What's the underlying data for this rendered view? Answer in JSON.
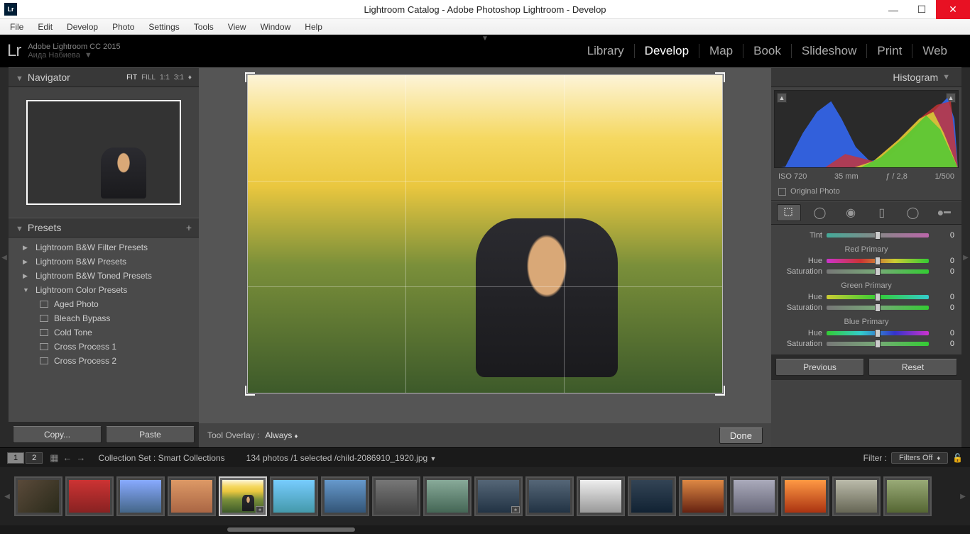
{
  "window": {
    "title": "Lightroom Catalog - Adobe Photoshop Lightroom - Develop",
    "lr_badge": "Lr"
  },
  "menu": [
    "File",
    "Edit",
    "Develop",
    "Photo",
    "Settings",
    "Tools",
    "View",
    "Window",
    "Help"
  ],
  "identity": {
    "logo": "Lr",
    "line1": "Adobe Lightroom CC 2015",
    "line2": "Аида Набиева"
  },
  "modules": [
    "Library",
    "Develop",
    "Map",
    "Book",
    "Slideshow",
    "Print",
    "Web"
  ],
  "active_module": 1,
  "navigator": {
    "title": "Navigator",
    "fit": "FIT",
    "fill": "FILL",
    "one": "1:1",
    "three": "3:1"
  },
  "presets": {
    "title": "Presets",
    "groups": [
      {
        "label": "Lightroom B&W Filter Presets",
        "expanded": false
      },
      {
        "label": "Lightroom B&W Presets",
        "expanded": false
      },
      {
        "label": "Lightroom B&W Toned Presets",
        "expanded": false
      },
      {
        "label": "Lightroom Color Presets",
        "expanded": true
      }
    ],
    "items": [
      "Aged Photo",
      "Bleach Bypass",
      "Cold Tone",
      "Cross Process 1",
      "Cross Process 2"
    ]
  },
  "copy_btn": "Copy...",
  "paste_btn": "Paste",
  "overlay": {
    "label": "Tool Overlay :",
    "value": "Always"
  },
  "done_btn": "Done",
  "histogram": {
    "title": "Histogram",
    "iso": "ISO 720",
    "focal": "35 mm",
    "aperture": "ƒ / 2,8",
    "shutter": "1/500",
    "original": "Original Photo"
  },
  "sliders": {
    "tint": {
      "label": "Tint",
      "val": "0"
    },
    "sections": [
      {
        "title": "Red Primary",
        "hue": "0",
        "sat": "0"
      },
      {
        "title": "Green Primary",
        "hue": "0",
        "sat": "0"
      },
      {
        "title": "Blue Primary",
        "hue": "0",
        "sat": "0"
      }
    ],
    "hue_label": "Hue",
    "sat_label": "Saturation"
  },
  "prev_btn": "Previous",
  "reset_btn": "Reset",
  "info": {
    "collection_label": "Collection Set :",
    "collection_name": "Smart Collections",
    "count": "134 photos /",
    "selected": "1 selected /",
    "filename": "child-2086910_1920.jpg",
    "filter_label": "Filter :",
    "filter_value": "Filters Off"
  },
  "view_modes": [
    "1",
    "2"
  ]
}
